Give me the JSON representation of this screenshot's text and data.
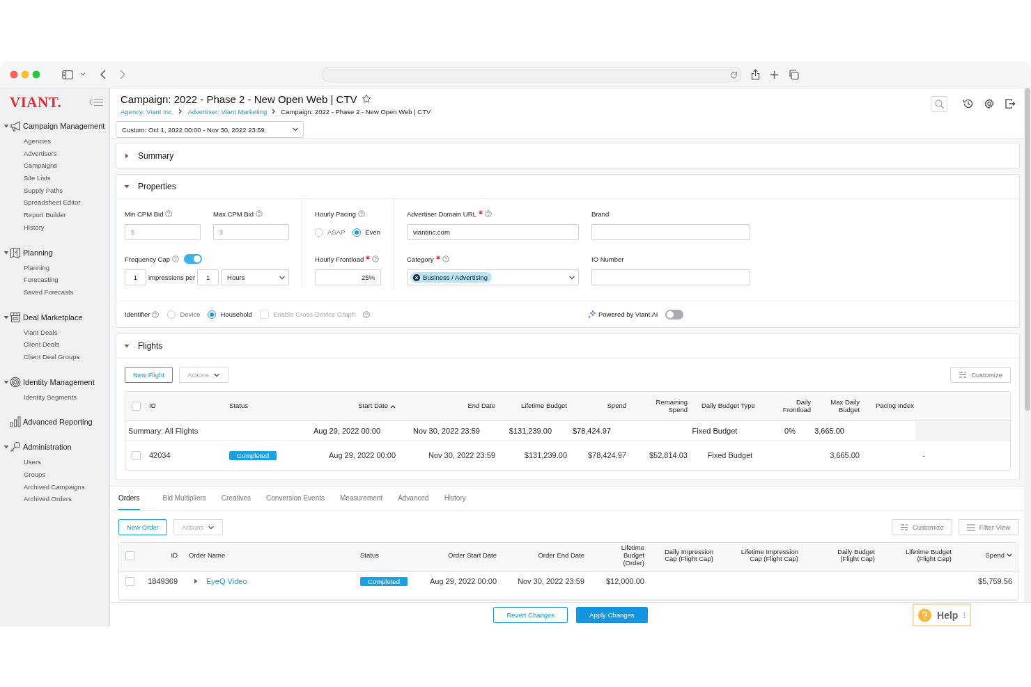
{
  "sidebar": {
    "logo": "VIANT.",
    "groups": [
      {
        "label": "Campaign Management",
        "expanded": true,
        "items": [
          "Agencies",
          "Advertisers",
          "Campaigns",
          "Site Lists",
          "Supply Paths",
          "Spreadsheet Editor",
          "Report Builder",
          "History"
        ]
      },
      {
        "label": "Planning",
        "expanded": true,
        "items": [
          "Planning",
          "Forecasting",
          "Saved Forecasts"
        ]
      },
      {
        "label": "Deal Marketplace",
        "expanded": true,
        "items": [
          "Viant Deals",
          "Client Deals",
          "Client Deal Groups"
        ]
      },
      {
        "label": "Identity Management",
        "expanded": true,
        "items": [
          "Identity Segments"
        ]
      },
      {
        "label": "Advanced Reporting"
      },
      {
        "label": "Administration",
        "expanded": true,
        "items": [
          "Users",
          "Groups",
          "Archived Campaigns",
          "Archived Orders"
        ]
      }
    ]
  },
  "header": {
    "title": "Campaign: 2022 - Phase 2 - New Open Web | CTV",
    "starred": false,
    "breadcrumbs": [
      {
        "label": "Agency: Viant Inc.",
        "link": true
      },
      {
        "label": "Advertiser: Viant Marketing",
        "link": true
      },
      {
        "label": "Campaign: 2022 - Phase 2 - New Open Web | CTV",
        "link": false
      }
    ],
    "date_range": "Custom: Oct 1, 2022 00:00 - Nov 30, 2022 23:59"
  },
  "summary": {
    "title": "Summary",
    "expanded": false
  },
  "properties": {
    "title": "Properties",
    "expanded": true,
    "min_cpm_bid": {
      "label": "Min CPM Bid",
      "help": true,
      "required": false,
      "placeholder": "$"
    },
    "max_cpm_bid": {
      "label": "Max CPM Bid",
      "help": true,
      "required": false,
      "placeholder": "$"
    },
    "frequency_cap": {
      "label": "Frequency Cap",
      "help": true,
      "on": true,
      "impressions": "1",
      "per_label": "impressions per",
      "per_value": "1",
      "unit": "Hours"
    },
    "hourly_pacing": {
      "label": "Hourly Pacing",
      "help": true,
      "options": [
        {
          "label": "ASAP",
          "selected": false
        },
        {
          "label": "Even",
          "selected": true
        }
      ]
    },
    "hourly_frontload": {
      "label": "Hourly Frontload",
      "help": true,
      "required": true,
      "value": "25%"
    },
    "advertiser_domain_url": {
      "label": "Advertiser Domain URL",
      "help": true,
      "required": true,
      "value": "viantinc.com"
    },
    "brand": {
      "label": "Brand",
      "help": false,
      "required": false
    },
    "category": {
      "label": "Category",
      "help": true,
      "required": true,
      "tags": [
        "Business / Advertising"
      ]
    },
    "io_number": {
      "label": "IO Number",
      "help": false,
      "required": false
    },
    "identifier": {
      "label": "Identifier",
      "help": true,
      "options": [
        {
          "label": "Device",
          "selected": false
        },
        {
          "label": "Household",
          "selected": true
        }
      ]
    },
    "cross_device": {
      "label": "Enable Cross-Device Graph",
      "help": true,
      "checked": false,
      "disabled": true
    },
    "viant_ai": {
      "label": "Powered by Viant AI",
      "on": false
    }
  },
  "flights": {
    "title": "Flights",
    "expanded": true,
    "new_button": "New Flight",
    "actions_button": "Actions",
    "customize_button": "Customize",
    "all_selected": false,
    "columns": [
      {
        "label": "ID",
        "kind": "text",
        "sorted": false
      },
      {
        "label": "Status",
        "kind": "status",
        "sorted": false
      },
      {
        "label": "Start Date",
        "kind": "text",
        "sorted": true,
        "descending": false
      },
      {
        "label": "End Date",
        "kind": "text",
        "sorted": false
      },
      {
        "label": "Lifetime Budget",
        "kind": "text",
        "sorted": false
      },
      {
        "label": "Spend",
        "kind": "text",
        "sorted": false
      },
      {
        "label": "Remaining Spend",
        "kind": "text",
        "sorted": false
      },
      {
        "label": "Daily Budget Type",
        "kind": "text",
        "sorted": false
      },
      {
        "label": "Daily Frontload",
        "kind": "text",
        "sorted": false
      },
      {
        "label": "Max Daily Budget",
        "kind": "text",
        "sorted": false
      },
      {
        "label": "Pacing Index",
        "kind": "text",
        "sorted": false
      }
    ],
    "summary_row": {
      "label": "Summary: All Flights",
      "cells": [
        "Aug 29, 2022 00:00",
        "Nov 30, 2022 23:59",
        "$131,239.00",
        "$78,424.97",
        null,
        "Fixed Budget",
        "0%",
        "3,665.00",
        null
      ]
    },
    "rows": [
      {
        "selected": false,
        "cells": [
          "42034",
          "Completed",
          "Aug 29, 2022 00:00",
          "Nov 30, 2022 23:59",
          "$131,239.00",
          "$78,424.97",
          "$52,814.03",
          "Fixed Budget",
          null,
          "3,665.00",
          "-"
        ]
      }
    ]
  },
  "tabs": [
    {
      "label": "Orders",
      "selected": true
    },
    {
      "label": "Bid Multipliers",
      "selected": false
    },
    {
      "label": "Creatives",
      "selected": false
    },
    {
      "label": "Conversion Events",
      "selected": false
    },
    {
      "label": "Measurement",
      "selected": false
    },
    {
      "label": "Advanced",
      "selected": false
    },
    {
      "label": "History",
      "selected": false
    }
  ],
  "orders": {
    "new_button": "New Order",
    "actions_button": "Actions",
    "customize_button": "Customize",
    "filter_button": "Filter View",
    "all_selected": false,
    "columns": [
      {
        "label": "ID",
        "kind": "text",
        "sorted": false
      },
      {
        "label": "Order Name",
        "kind": "link",
        "sorted": false
      },
      {
        "label": "Status",
        "kind": "status",
        "sorted": false
      },
      {
        "label": "Order Start Date",
        "kind": "text",
        "sorted": false
      },
      {
        "label": "Order End Date",
        "kind": "text",
        "sorted": false
      },
      {
        "label": "Lifetime Budget (Order)",
        "kind": "text",
        "sorted": false
      },
      {
        "label": "Daily Impression Cap (Flight Cap)",
        "kind": "text",
        "sorted": false
      },
      {
        "label": "Lifetime Impression Cap (Flight Cap)",
        "kind": "text",
        "sorted": false
      },
      {
        "label": "Daily Budget (Flight Cap)",
        "kind": "text",
        "sorted": false
      },
      {
        "label": "Lifetime Budget (Flight Cap)",
        "kind": "text",
        "sorted": false
      },
      {
        "label": "Spend",
        "kind": "text",
        "sorted": true,
        "descending": true
      }
    ],
    "rows": [
      {
        "selected": false,
        "expanded": false,
        "cells": [
          "1849369",
          "EyeQ Video",
          "Completed",
          "Aug 29, 2022 00:00",
          "Nov 30, 2022 23:59",
          "$12,000.00",
          null,
          null,
          null,
          null,
          "$5,759.56"
        ]
      }
    ]
  },
  "footer": {
    "revert_button": "Revert Changes",
    "apply_button": "Apply Changes",
    "help": "Help"
  }
}
